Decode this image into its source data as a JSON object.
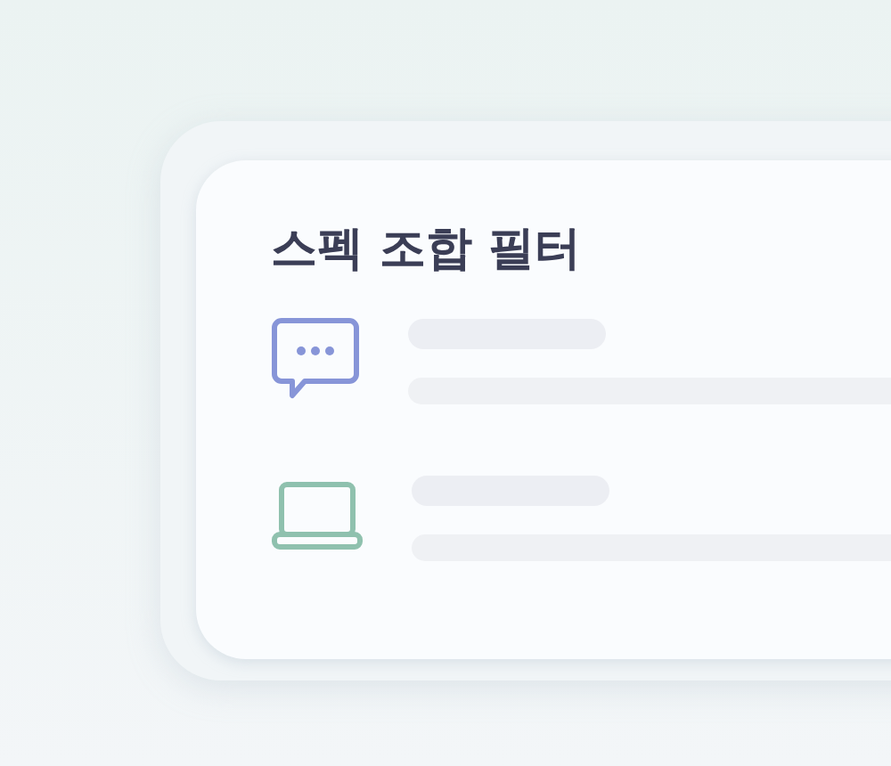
{
  "card": {
    "title": "스펙 조합 필터",
    "items": [
      {
        "kind": "chat",
        "color": "#8795d8"
      },
      {
        "kind": "laptop",
        "color": "#8fc1ae"
      }
    ]
  }
}
